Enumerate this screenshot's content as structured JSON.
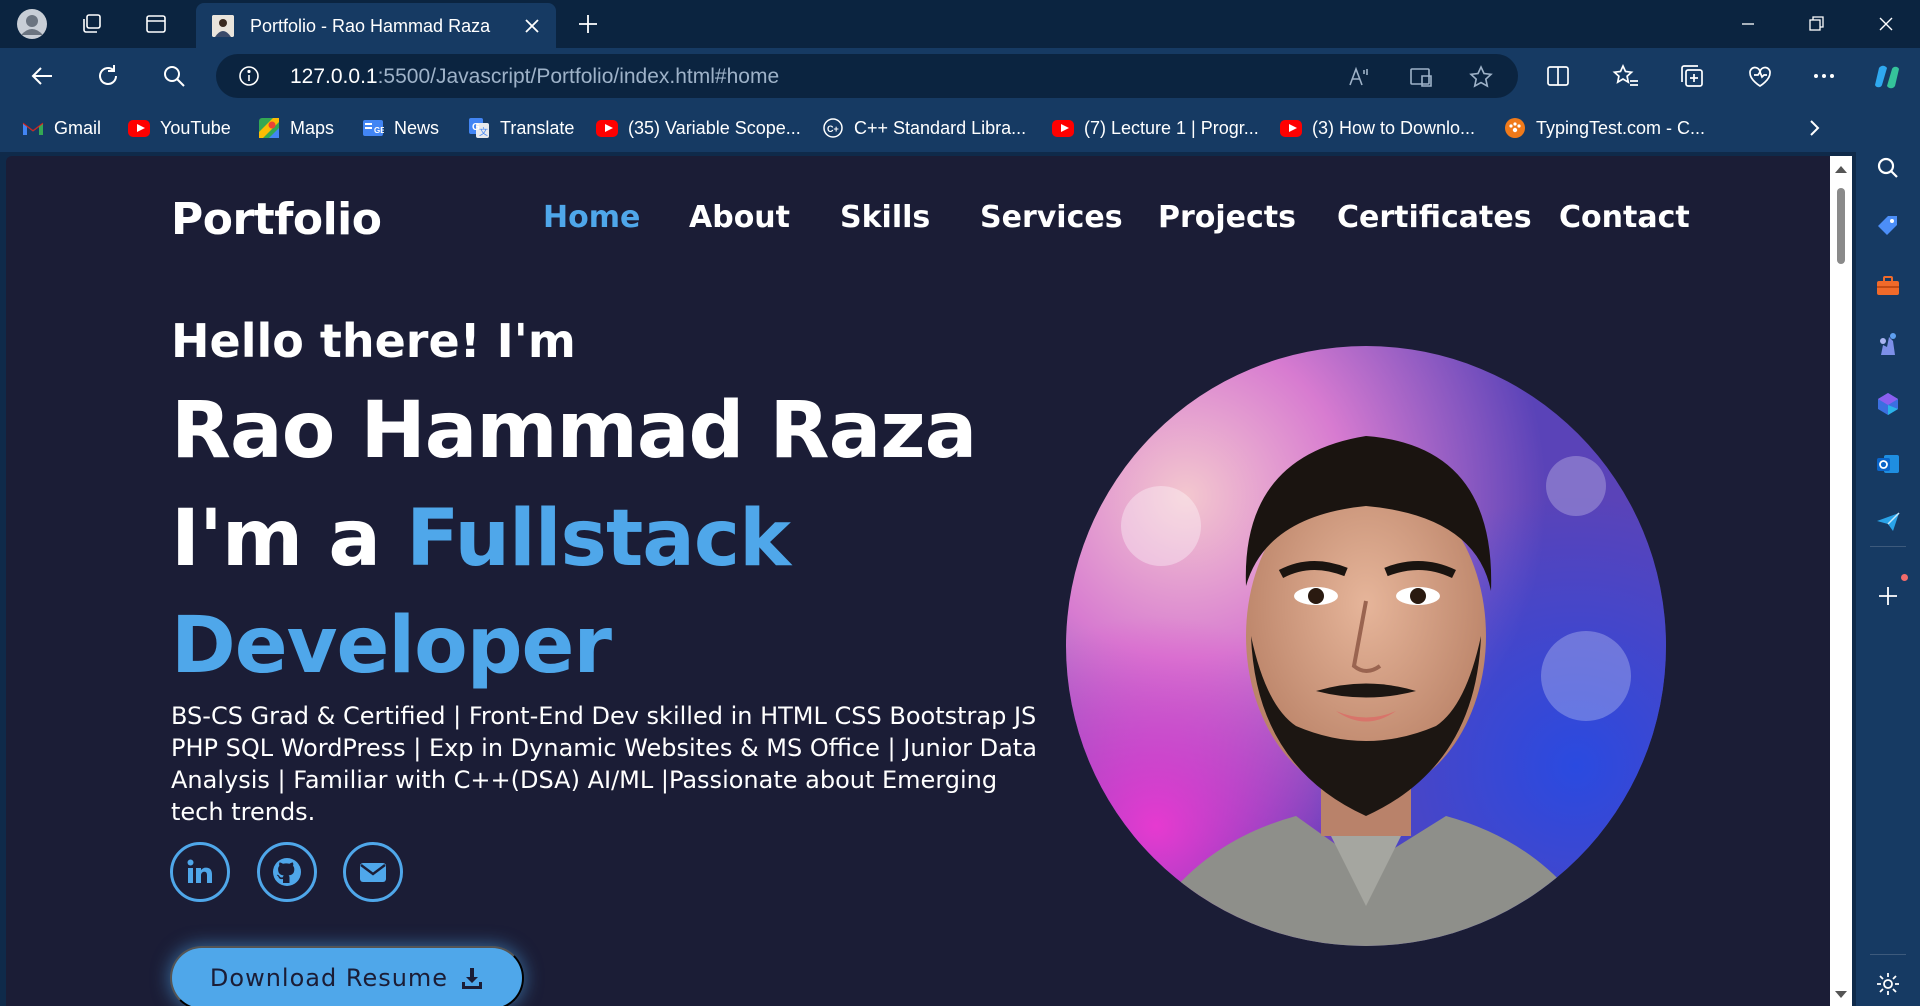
{
  "browser": {
    "tab_title": "Portfolio - Rao Hammad Raza",
    "url_host": "127.0.0.1",
    "url_path": ":5500/Javascript/Portfolio/index.html#home",
    "bookmarks": [
      {
        "label": "Gmail",
        "icon": "gmail-icon"
      },
      {
        "label": "YouTube",
        "icon": "youtube-icon"
      },
      {
        "label": "Maps",
        "icon": "maps-icon"
      },
      {
        "label": "News",
        "icon": "news-icon"
      },
      {
        "label": "Translate",
        "icon": "translate-icon"
      },
      {
        "label": "(35) Variable Scope...",
        "icon": "youtube-icon"
      },
      {
        "label": "C++ Standard Libra...",
        "icon": "cplusplus-icon"
      },
      {
        "label": "(7) Lecture 1 | Progr...",
        "icon": "youtube-icon"
      },
      {
        "label": "(3) How to Downlo...",
        "icon": "youtube-icon"
      },
      {
        "label": "TypingTest.com - C...",
        "icon": "typingtest-icon"
      }
    ]
  },
  "site": {
    "logo": "Portfolio",
    "nav": [
      "Home",
      "About",
      "Skills",
      "Services",
      "Projects",
      "Certificates",
      "Contact"
    ],
    "active_nav": "Home",
    "greeting": "Hello there! I'm",
    "name": "Rao Hammad Raza",
    "role_prefix": "I'm a ",
    "role_line1": "Fullstack",
    "role_line2": "Developer",
    "bio": "BS-CS Grad & Certified | Front-End Dev skilled in HTML CSS Bootstrap JS PHP SQL WordPress | Exp in Dynamic Websites & MS Office | Junior Data Analysis | Familiar with C++(DSA) AI/ML |Passionate about Emerging tech trends.",
    "social": [
      "linkedin-icon",
      "github-icon",
      "email-icon"
    ],
    "download_label": "Download Resume"
  },
  "colors": {
    "accent": "#4fa7ea",
    "page_bg": "#1b1d36",
    "browser_frame": "#163a63"
  }
}
